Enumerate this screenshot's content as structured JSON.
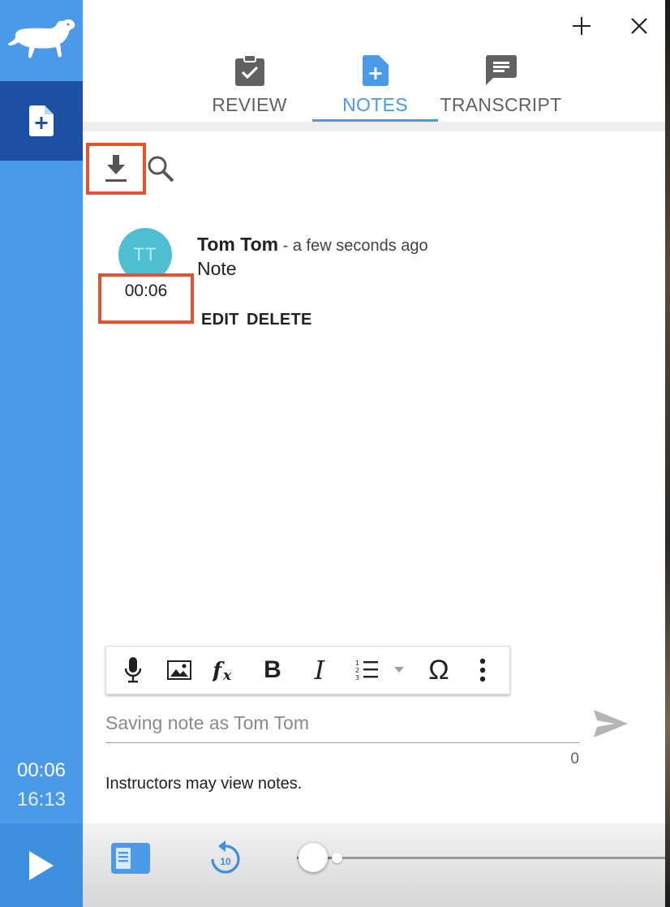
{
  "rail": {
    "logo_icon": "dachshund-logo-icon",
    "notes_icon": "note-add-icon",
    "current_time": "00:06",
    "total_time": "16:13",
    "play_icon": "play-icon"
  },
  "header": {
    "add_icon": "plus-icon",
    "close_icon": "close-icon"
  },
  "tabs": [
    {
      "label": "REVIEW",
      "icon": "clipboard-check-icon",
      "active": false
    },
    {
      "label": "NOTES",
      "icon": "note-add-icon",
      "active": true
    },
    {
      "label": "TRANSCRIPT",
      "icon": "message-lines-icon",
      "active": false
    }
  ],
  "notes_toolbar": {
    "download_icon": "download-icon",
    "search_icon": "search-icon"
  },
  "note": {
    "avatar_initials": "TT",
    "timestamp": "00:06",
    "author": "Tom Tom",
    "time_ago": " - a few seconds ago",
    "body": "Note",
    "edit_label": "EDIT",
    "delete_label": "DELETE"
  },
  "editor": {
    "tools": [
      "microphone-icon",
      "image-icon",
      "formula-icon",
      "bold-icon",
      "italic-icon",
      "numbered-list-icon",
      "dropdown-caret-icon",
      "omega-icon",
      "more-vertical-icon"
    ],
    "bold_glyph": "B",
    "italic_glyph": "I",
    "omega_glyph": "Ω",
    "input_value": "",
    "placeholder": "Saving note as Tom Tom",
    "char_count": "0",
    "send_icon": "send-icon",
    "notice": "Instructors may view notes."
  },
  "player": {
    "transcript_toggle_icon": "subtitles-icon",
    "rewind_icon": "replay-10-icon",
    "rewind_label": "10",
    "progress": 0.006
  },
  "colors": {
    "accent": "#4a9ae9",
    "rail_dark": "#1d4fa3",
    "highlight": "#e8512f",
    "avatar": "#4ebfd0"
  }
}
